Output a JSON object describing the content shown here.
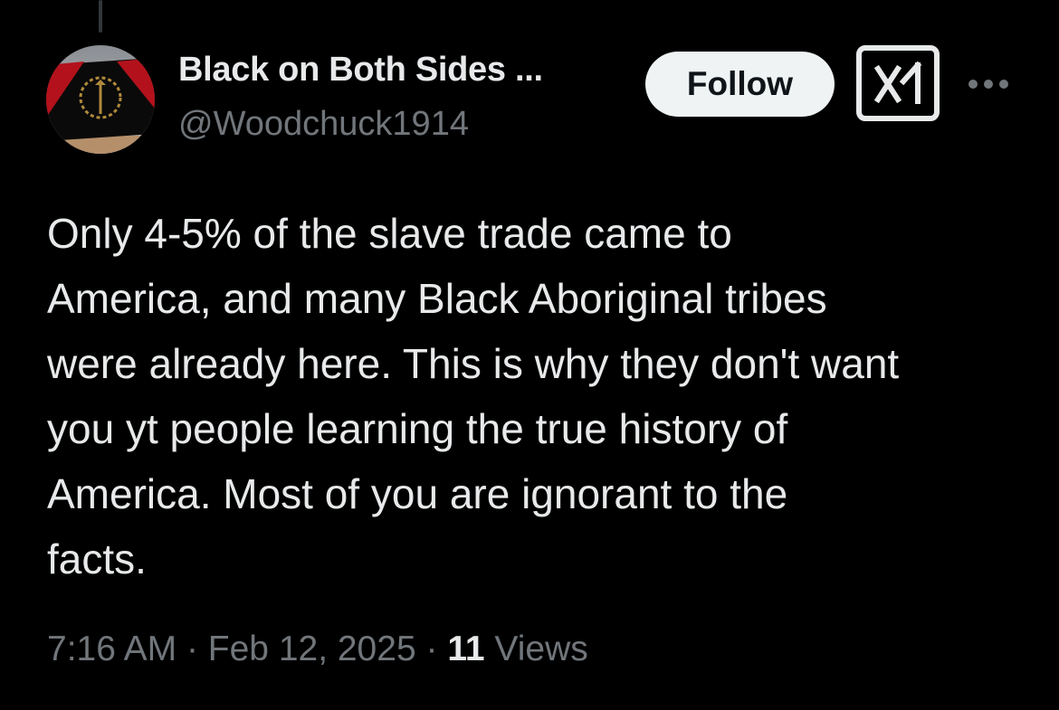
{
  "tweet": {
    "author": {
      "display_name": "Black on Both Sides ...",
      "handle": "@Woodchuck1914",
      "avatar_icon": "flag-laurel-avatar-icon"
    },
    "follow_label": "Follow",
    "grok_icon": "grok-icon",
    "more_icon": "more-options-icon",
    "text": "Only 4-5% of the slave trade came to\nAmerica, and many Black Aboriginal tribes\nwere already here. This is why they don't want\nyou yt people learning the true history of\nAmerica. Most of you are ignorant to the\nfacts.",
    "time": "7:16 AM",
    "separator": "·",
    "date": "Feb 12, 2025",
    "views_count": "11",
    "views_label": "Views"
  },
  "colors": {
    "background": "#000000",
    "primary_text": "#e7e9ea",
    "secondary_text": "#71767b",
    "follow_bg": "#eff3f4",
    "follow_text": "#0f1419"
  }
}
